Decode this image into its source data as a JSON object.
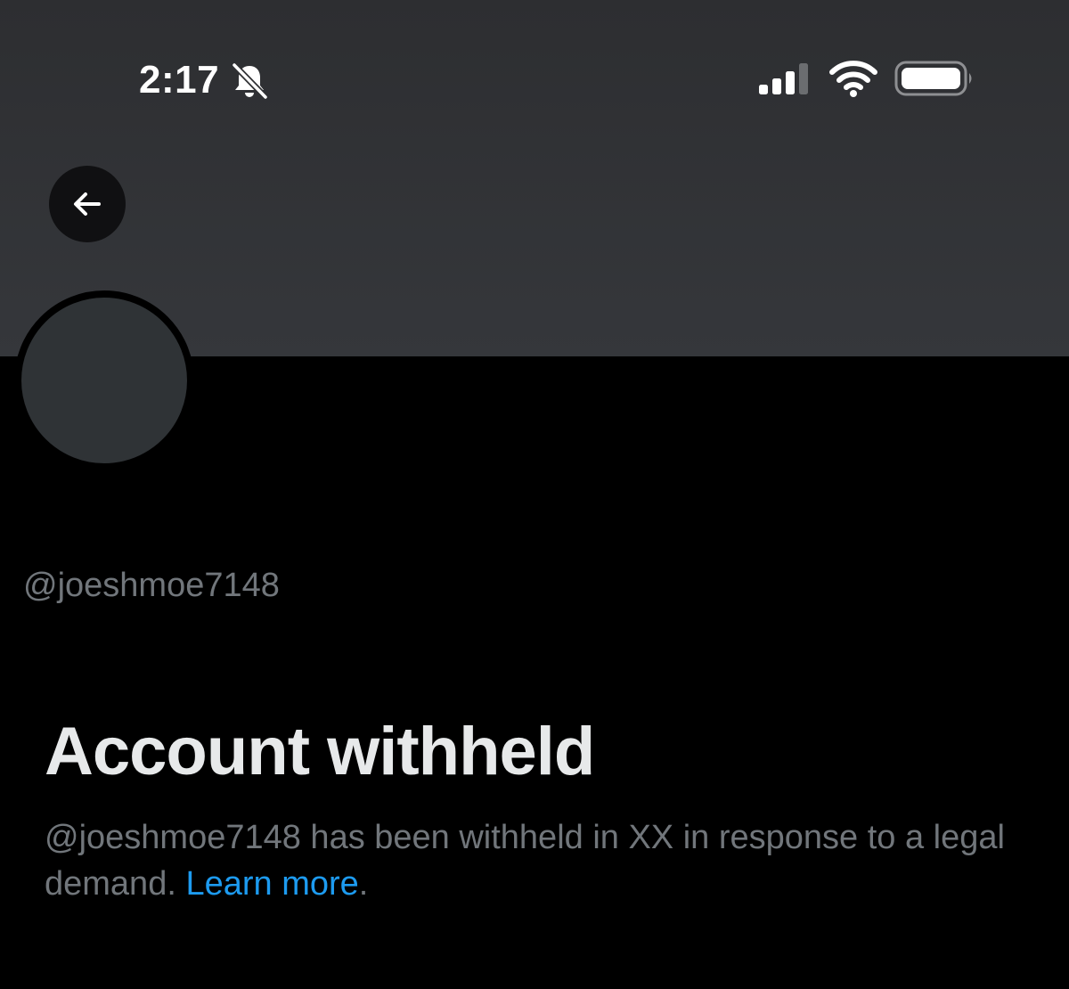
{
  "status_bar": {
    "time": "2:17",
    "bell_icon": "bell-slash-icon",
    "signal_icon": "cellular-signal-icon",
    "wifi_icon": "wifi-icon",
    "battery_icon": "battery-icon"
  },
  "header": {
    "back_icon": "arrow-left-icon"
  },
  "profile": {
    "handle": "@joeshmoe7148"
  },
  "notice": {
    "title": "Account withheld",
    "message_prefix": "@joeshmoe7148 has been withheld in XX in response to a legal demand. ",
    "link_label": "Learn more",
    "message_suffix": "."
  },
  "colors": {
    "background": "#000000",
    "banner": "#323437",
    "avatar": "#2f3336",
    "secondary_text": "#71767b",
    "primary_text": "#e7e9ea",
    "link": "#1d9bf0"
  }
}
